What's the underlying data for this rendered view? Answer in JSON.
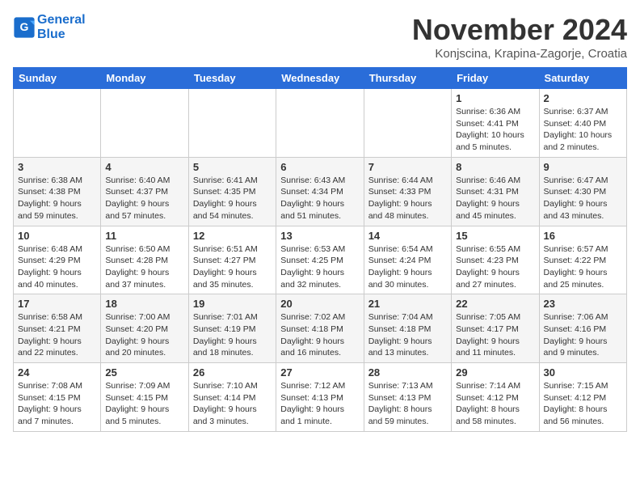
{
  "app": {
    "logo_line1": "General",
    "logo_line2": "Blue"
  },
  "header": {
    "month": "November 2024",
    "location": "Konjscina, Krapina-Zagorje, Croatia"
  },
  "weekdays": [
    "Sunday",
    "Monday",
    "Tuesday",
    "Wednesday",
    "Thursday",
    "Friday",
    "Saturday"
  ],
  "weeks": [
    [
      {
        "day": "",
        "info": ""
      },
      {
        "day": "",
        "info": ""
      },
      {
        "day": "",
        "info": ""
      },
      {
        "day": "",
        "info": ""
      },
      {
        "day": "",
        "info": ""
      },
      {
        "day": "1",
        "info": "Sunrise: 6:36 AM\nSunset: 4:41 PM\nDaylight: 10 hours\nand 5 minutes."
      },
      {
        "day": "2",
        "info": "Sunrise: 6:37 AM\nSunset: 4:40 PM\nDaylight: 10 hours\nand 2 minutes."
      }
    ],
    [
      {
        "day": "3",
        "info": "Sunrise: 6:38 AM\nSunset: 4:38 PM\nDaylight: 9 hours\nand 59 minutes."
      },
      {
        "day": "4",
        "info": "Sunrise: 6:40 AM\nSunset: 4:37 PM\nDaylight: 9 hours\nand 57 minutes."
      },
      {
        "day": "5",
        "info": "Sunrise: 6:41 AM\nSunset: 4:35 PM\nDaylight: 9 hours\nand 54 minutes."
      },
      {
        "day": "6",
        "info": "Sunrise: 6:43 AM\nSunset: 4:34 PM\nDaylight: 9 hours\nand 51 minutes."
      },
      {
        "day": "7",
        "info": "Sunrise: 6:44 AM\nSunset: 4:33 PM\nDaylight: 9 hours\nand 48 minutes."
      },
      {
        "day": "8",
        "info": "Sunrise: 6:46 AM\nSunset: 4:31 PM\nDaylight: 9 hours\nand 45 minutes."
      },
      {
        "day": "9",
        "info": "Sunrise: 6:47 AM\nSunset: 4:30 PM\nDaylight: 9 hours\nand 43 minutes."
      }
    ],
    [
      {
        "day": "10",
        "info": "Sunrise: 6:48 AM\nSunset: 4:29 PM\nDaylight: 9 hours\nand 40 minutes."
      },
      {
        "day": "11",
        "info": "Sunrise: 6:50 AM\nSunset: 4:28 PM\nDaylight: 9 hours\nand 37 minutes."
      },
      {
        "day": "12",
        "info": "Sunrise: 6:51 AM\nSunset: 4:27 PM\nDaylight: 9 hours\nand 35 minutes."
      },
      {
        "day": "13",
        "info": "Sunrise: 6:53 AM\nSunset: 4:25 PM\nDaylight: 9 hours\nand 32 minutes."
      },
      {
        "day": "14",
        "info": "Sunrise: 6:54 AM\nSunset: 4:24 PM\nDaylight: 9 hours\nand 30 minutes."
      },
      {
        "day": "15",
        "info": "Sunrise: 6:55 AM\nSunset: 4:23 PM\nDaylight: 9 hours\nand 27 minutes."
      },
      {
        "day": "16",
        "info": "Sunrise: 6:57 AM\nSunset: 4:22 PM\nDaylight: 9 hours\nand 25 minutes."
      }
    ],
    [
      {
        "day": "17",
        "info": "Sunrise: 6:58 AM\nSunset: 4:21 PM\nDaylight: 9 hours\nand 22 minutes."
      },
      {
        "day": "18",
        "info": "Sunrise: 7:00 AM\nSunset: 4:20 PM\nDaylight: 9 hours\nand 20 minutes."
      },
      {
        "day": "19",
        "info": "Sunrise: 7:01 AM\nSunset: 4:19 PM\nDaylight: 9 hours\nand 18 minutes."
      },
      {
        "day": "20",
        "info": "Sunrise: 7:02 AM\nSunset: 4:18 PM\nDaylight: 9 hours\nand 16 minutes."
      },
      {
        "day": "21",
        "info": "Sunrise: 7:04 AM\nSunset: 4:18 PM\nDaylight: 9 hours\nand 13 minutes."
      },
      {
        "day": "22",
        "info": "Sunrise: 7:05 AM\nSunset: 4:17 PM\nDaylight: 9 hours\nand 11 minutes."
      },
      {
        "day": "23",
        "info": "Sunrise: 7:06 AM\nSunset: 4:16 PM\nDaylight: 9 hours\nand 9 minutes."
      }
    ],
    [
      {
        "day": "24",
        "info": "Sunrise: 7:08 AM\nSunset: 4:15 PM\nDaylight: 9 hours\nand 7 minutes."
      },
      {
        "day": "25",
        "info": "Sunrise: 7:09 AM\nSunset: 4:15 PM\nDaylight: 9 hours\nand 5 minutes."
      },
      {
        "day": "26",
        "info": "Sunrise: 7:10 AM\nSunset: 4:14 PM\nDaylight: 9 hours\nand 3 minutes."
      },
      {
        "day": "27",
        "info": "Sunrise: 7:12 AM\nSunset: 4:13 PM\nDaylight: 9 hours\nand 1 minute."
      },
      {
        "day": "28",
        "info": "Sunrise: 7:13 AM\nSunset: 4:13 PM\nDaylight: 8 hours\nand 59 minutes."
      },
      {
        "day": "29",
        "info": "Sunrise: 7:14 AM\nSunset: 4:12 PM\nDaylight: 8 hours\nand 58 minutes."
      },
      {
        "day": "30",
        "info": "Sunrise: 7:15 AM\nSunset: 4:12 PM\nDaylight: 8 hours\nand 56 minutes."
      }
    ]
  ]
}
